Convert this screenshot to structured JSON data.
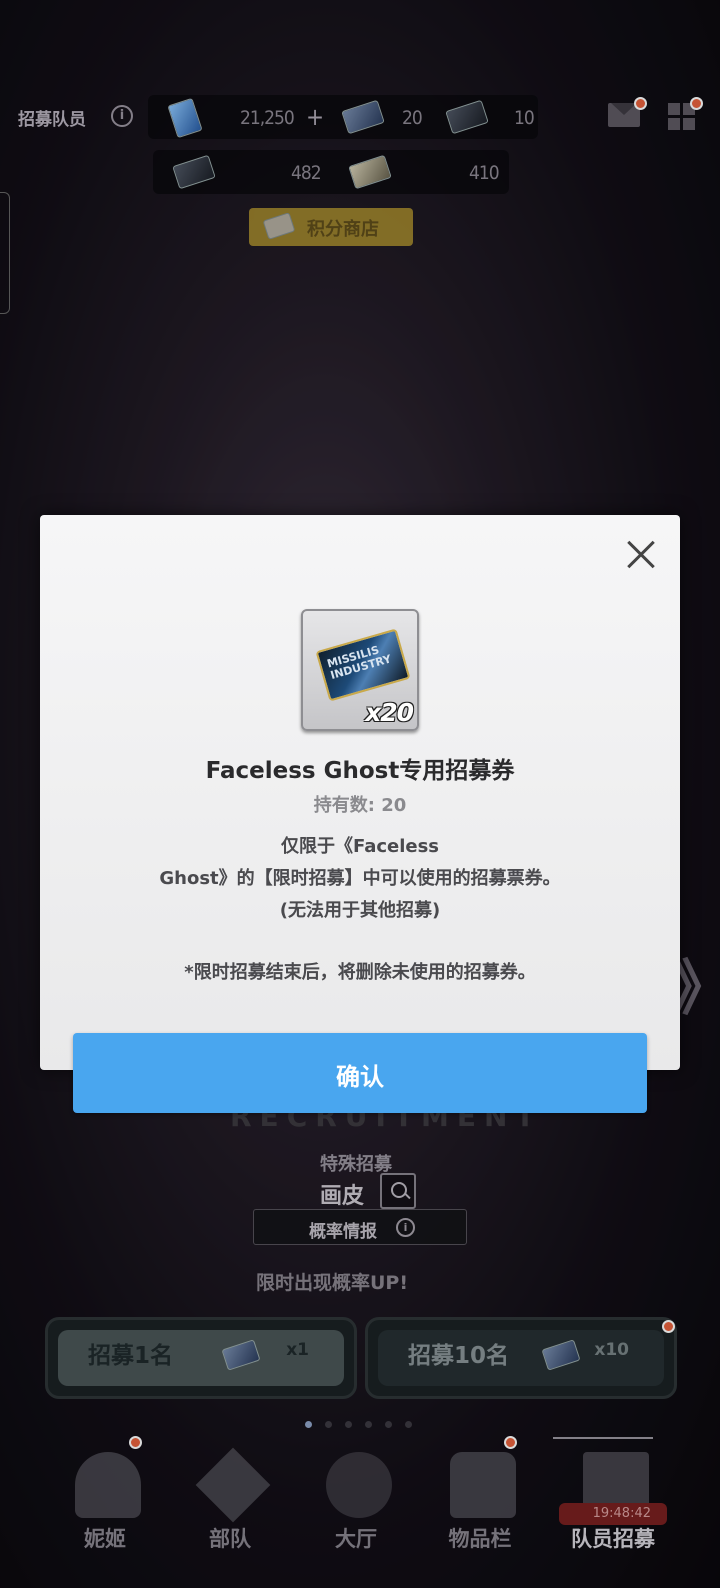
{
  "header": {
    "page_label": "招募队员",
    "info_glyph": "i",
    "resources_row1": [
      {
        "icon": "gem-ticket-icon",
        "value": "21,250",
        "plus": "+"
      },
      {
        "icon": "recruit-ticket-icon",
        "value": "20"
      },
      {
        "icon": "advanced-ticket-icon",
        "value": "10"
      }
    ],
    "resources_row2": [
      {
        "icon": "dark-ticket-icon",
        "value": "482"
      },
      {
        "icon": "gold-ticket-icon",
        "value": "410"
      }
    ],
    "shop_label": "积分商店"
  },
  "background": {
    "banner_text": "RECRUITMENT",
    "special_label": "特殊招募",
    "skin_label": "画皮",
    "prob_label": "概率情报",
    "prob_info_glyph": "i",
    "limited_up": "限时出现概率UP!",
    "recruit_one": {
      "label": "招募1名",
      "count": "x1"
    },
    "recruit_ten": {
      "label": "招募10名",
      "count": "x10"
    },
    "arrow_left": "《",
    "arrow_right": "》"
  },
  "bottom_nav": {
    "items": [
      {
        "label": "妮姬",
        "icon": "nikke-icon"
      },
      {
        "label": "部队",
        "icon": "squad-icon"
      },
      {
        "label": "大厅",
        "icon": "lobby-icon"
      },
      {
        "label": "物品栏",
        "icon": "inventory-icon"
      },
      {
        "label": "队员招募",
        "icon": "recruit-icon"
      }
    ],
    "timer": "19:48:42"
  },
  "modal": {
    "item_card_text": "MISSILIS INDUSTRY",
    "item_quantity": "x20",
    "title": "Faceless Ghost专用招募券",
    "owned": "持有数: 20",
    "desc_line1": "仅限于《Faceless",
    "desc_line2": "Ghost》的【限时招募】中可以使用的招募票券。",
    "desc_line3": "(无法用于其他招募)",
    "note": "*限时招募结束后，将删除未使用的招募券。",
    "confirm_label": "确认"
  }
}
